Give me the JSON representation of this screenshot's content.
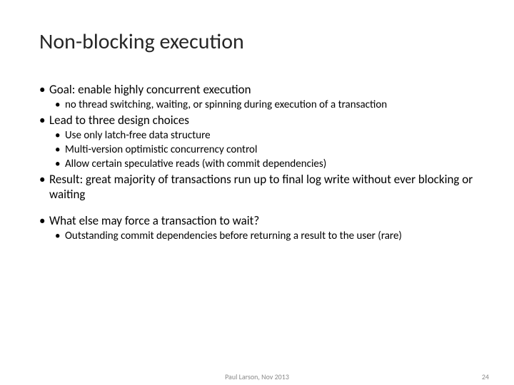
{
  "title": "Non-blocking execution",
  "bullets": {
    "b1_1": "Goal: enable highly concurrent execution",
    "b1_1_sub1": "no thread switching, waiting, or spinning during execution of a transaction",
    "b1_2": "Lead to three design choices",
    "b1_2_sub1": "Use only latch-free data structure",
    "b1_2_sub2": "Multi-version optimistic concurrency control",
    "b1_2_sub3": "Allow certain speculative reads (with commit dependencies)",
    "b1_3": "Result: great majority of transactions run up to final log write without ever blocking or waiting",
    "b1_4": "What else may force a transaction to wait?",
    "b1_4_sub1": "Outstanding commit dependencies before returning a result to the user (rare)"
  },
  "footer": {
    "author": "Paul Larson, Nov 2013",
    "page": "24"
  },
  "dot": "•"
}
